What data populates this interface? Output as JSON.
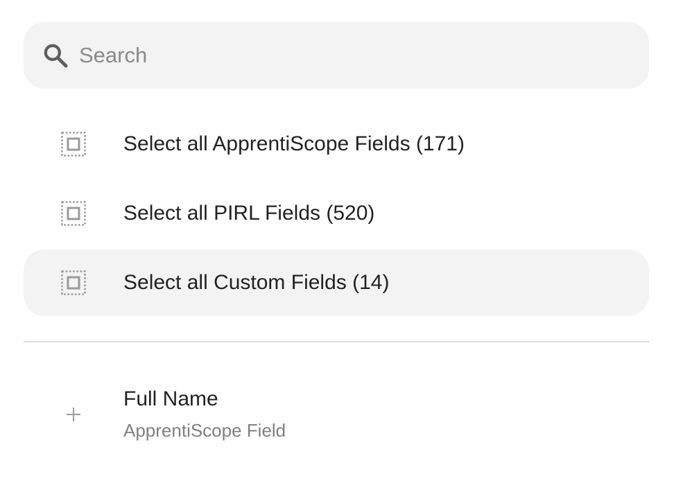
{
  "search": {
    "placeholder": "Search",
    "value": "",
    "icon": "search-icon"
  },
  "select_options": [
    {
      "label": "Select all ApprentiScope Fields (171)",
      "icon": "select-all-icon",
      "highlighted": false
    },
    {
      "label": "Select all PIRL Fields (520)",
      "icon": "select-all-icon",
      "highlighted": false
    },
    {
      "label": "Select all Custom Fields (14)",
      "icon": "select-all-icon",
      "highlighted": true
    }
  ],
  "fields": [
    {
      "title": "Full Name",
      "subtitle": "ApprentiScope Field",
      "icon": "plus-icon"
    }
  ],
  "colors": {
    "background": "#ffffff",
    "surface": "#f3f3f3",
    "text": "#222222",
    "muted_text": "#808080",
    "icon": "#9a9a9a",
    "divider": "#dddddd"
  }
}
